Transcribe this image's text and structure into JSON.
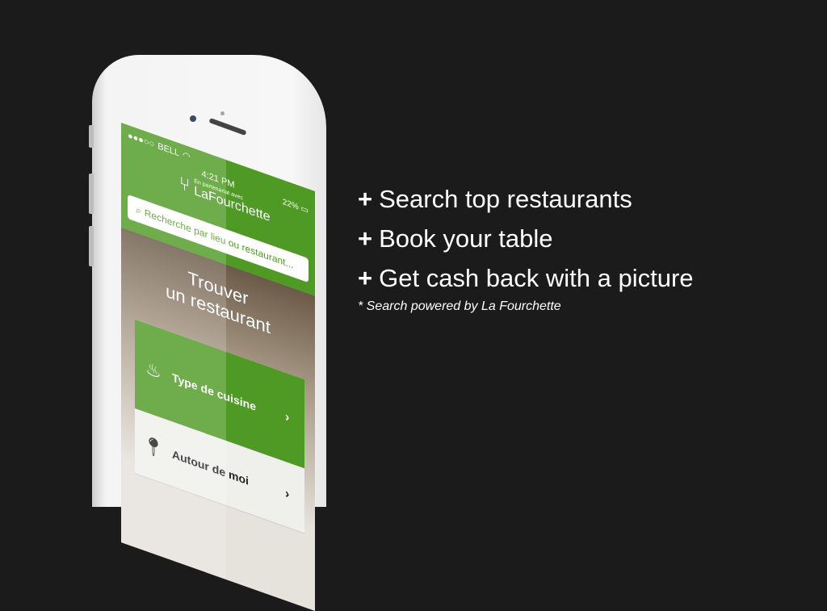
{
  "phone": {
    "status": {
      "carrier": "BELL",
      "time": "4:21 PM",
      "battery": "22%"
    },
    "logo": {
      "partner_text": "En partenariat avec",
      "brand": "LaFourchette"
    },
    "search": {
      "placeholder": "Recherche par lieu ou restaurant..."
    },
    "title_line1": "Trouver",
    "title_line2": "un restaurant",
    "menu": [
      {
        "label": "Type de cuisine",
        "icon": "cooking-pot-icon"
      },
      {
        "label": "Autour de moi",
        "icon": "map-pin-icon"
      }
    ]
  },
  "features": [
    "Search top restaurants",
    "Book your table",
    "Get cash back with a picture"
  ],
  "bullet_symbol": "+",
  "footnote": "* Search powered by La Fourchette",
  "colors": {
    "brand_green": "#4f9a25",
    "background": "#1b1b1b"
  }
}
